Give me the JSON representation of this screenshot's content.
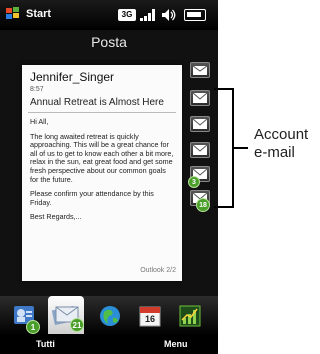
{
  "status_bar": {
    "start_label": "Start",
    "network_label": "3G"
  },
  "app": {
    "title": "Posta"
  },
  "message": {
    "sender": "Jennifer_Singer",
    "time": "8:57",
    "subject": "Annual Retreat is Almost Here",
    "greeting": "Hi All,",
    "paragraph1": "The long awaited retreat is quickly approaching. This will be a great chance for all of us to get to know each other a bit more, relax in the sun, eat great food and get some fresh perspective about our common goals for the future.",
    "paragraph2": "Please confirm your attendance by this Friday.",
    "closing": "Best Regards,...",
    "footer": "Outlook 2/2"
  },
  "accounts": [
    {
      "name": "account-1",
      "badge": ""
    },
    {
      "name": "account-2",
      "badge": ""
    },
    {
      "name": "account-3",
      "badge": ""
    },
    {
      "name": "account-4",
      "badge": ""
    },
    {
      "name": "account-5",
      "badge": "3"
    },
    {
      "name": "account-6",
      "badge": "18"
    }
  ],
  "annotation": {
    "line1": "Account",
    "line2": "e-mail"
  },
  "tabs": {
    "contacts_badge": "1",
    "mail_badge": "21",
    "calendar_day": "16"
  },
  "softkeys": {
    "left": "Tutti",
    "right": "Menu"
  },
  "colors": {
    "accent": "#4a9f2a",
    "frame": "#111111"
  }
}
